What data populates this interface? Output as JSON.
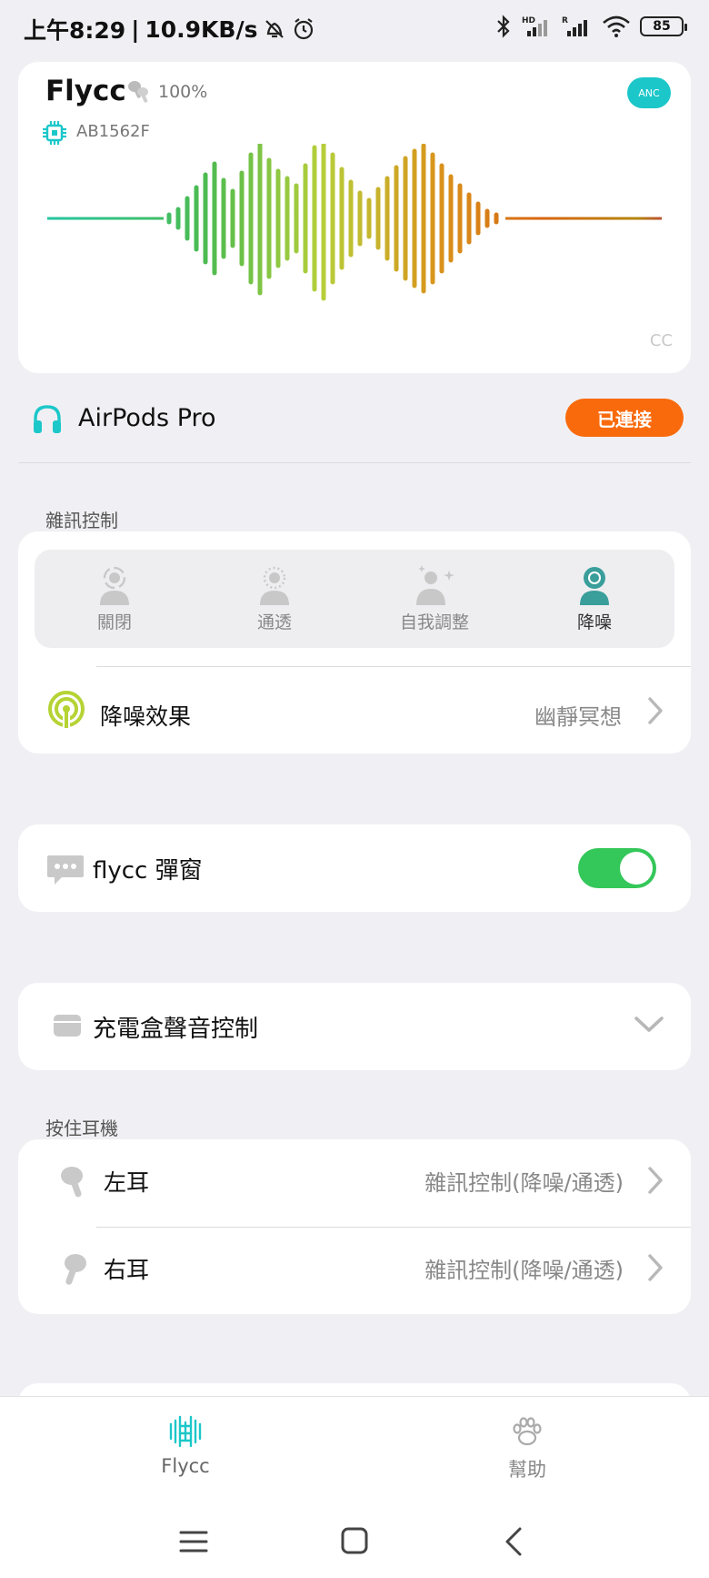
{
  "status_bar": {
    "time": "上午8:29",
    "network_speed": "10.9KB/s",
    "battery": "85",
    "icons": [
      "bell-off-icon",
      "alarm-icon",
      "bluetooth-icon",
      "signal-hd-icon",
      "signal-r-icon",
      "wifi-icon",
      "battery-icon"
    ]
  },
  "hero": {
    "app_name": "Flycc",
    "case_battery": "100%",
    "chip": "AB1562F",
    "anc_badge": "ANC",
    "footer": "CC"
  },
  "device": {
    "name": "AirPods Pro",
    "status": "已連接"
  },
  "noise_control": {
    "section_title": "雜訊控制",
    "modes": [
      {
        "label": "關閉",
        "icon": "off-person-icon",
        "active": false
      },
      {
        "label": "通透",
        "icon": "transparency-person-icon",
        "active": false
      },
      {
        "label": "自我調整",
        "icon": "adaptive-person-icon",
        "active": false
      },
      {
        "label": "降噪",
        "icon": "anc-person-icon",
        "active": true
      }
    ],
    "effect_label": "降噪效果",
    "effect_value": "幽靜冥想"
  },
  "popup": {
    "label": "flycc 彈窗",
    "enabled": true
  },
  "case_sound": {
    "label": "充電盒聲音控制"
  },
  "press_hold": {
    "section_title": "按住耳機",
    "rows": [
      {
        "label": "左耳",
        "value": "雜訊控制(降噪/通透)"
      },
      {
        "label": "右耳",
        "value": "雜訊控制(降噪/通透)"
      }
    ]
  },
  "tabs": [
    {
      "label": "Flycc",
      "active": true
    },
    {
      "label": "幫助",
      "active": false
    }
  ],
  "colors": {
    "accent": "#1cc7c9",
    "connected": "#f96a0c",
    "toggle_on": "#34c759",
    "active_mode": "#3a9e9b"
  }
}
